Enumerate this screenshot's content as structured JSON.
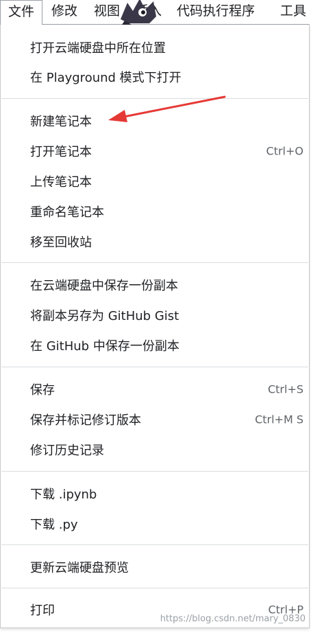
{
  "menubar": {
    "items": [
      {
        "label": "文件"
      },
      {
        "label": "修改"
      },
      {
        "label": "视图"
      },
      {
        "label": "插入"
      },
      {
        "label": "代码执行程序"
      },
      {
        "label": "工具"
      }
    ]
  },
  "menu": {
    "groups": [
      [
        {
          "label": "打开云端硬盘中所在位置",
          "shortcut": ""
        },
        {
          "label": "在 Playground 模式下打开",
          "shortcut": ""
        }
      ],
      [
        {
          "label": "新建笔记本",
          "shortcut": ""
        },
        {
          "label": "打开笔记本",
          "shortcut": "Ctrl+O"
        },
        {
          "label": "上传笔记本",
          "shortcut": ""
        },
        {
          "label": "重命名笔记本",
          "shortcut": ""
        },
        {
          "label": "移至回收站",
          "shortcut": ""
        }
      ],
      [
        {
          "label": "在云端硬盘中保存一份副本",
          "shortcut": ""
        },
        {
          "label": "将副本另存为 GitHub Gist",
          "shortcut": ""
        },
        {
          "label": "在 GitHub 中保存一份副本",
          "shortcut": ""
        }
      ],
      [
        {
          "label": "保存",
          "shortcut": "Ctrl+S"
        },
        {
          "label": "保存并标记修订版本",
          "shortcut": "Ctrl+M S"
        },
        {
          "label": "修订历史记录",
          "shortcut": ""
        }
      ],
      [
        {
          "label": "下载 .ipynb",
          "shortcut": ""
        },
        {
          "label": "下载 .py",
          "shortcut": ""
        }
      ],
      [
        {
          "label": "更新云端硬盘预览",
          "shortcut": ""
        }
      ],
      [
        {
          "label": "打印",
          "shortcut": "Ctrl+P"
        }
      ]
    ]
  },
  "annotation": {
    "arrow_color": "#e53935",
    "target": "新建笔记本"
  },
  "watermark": "https://blog.csdn.net/mary_0830"
}
